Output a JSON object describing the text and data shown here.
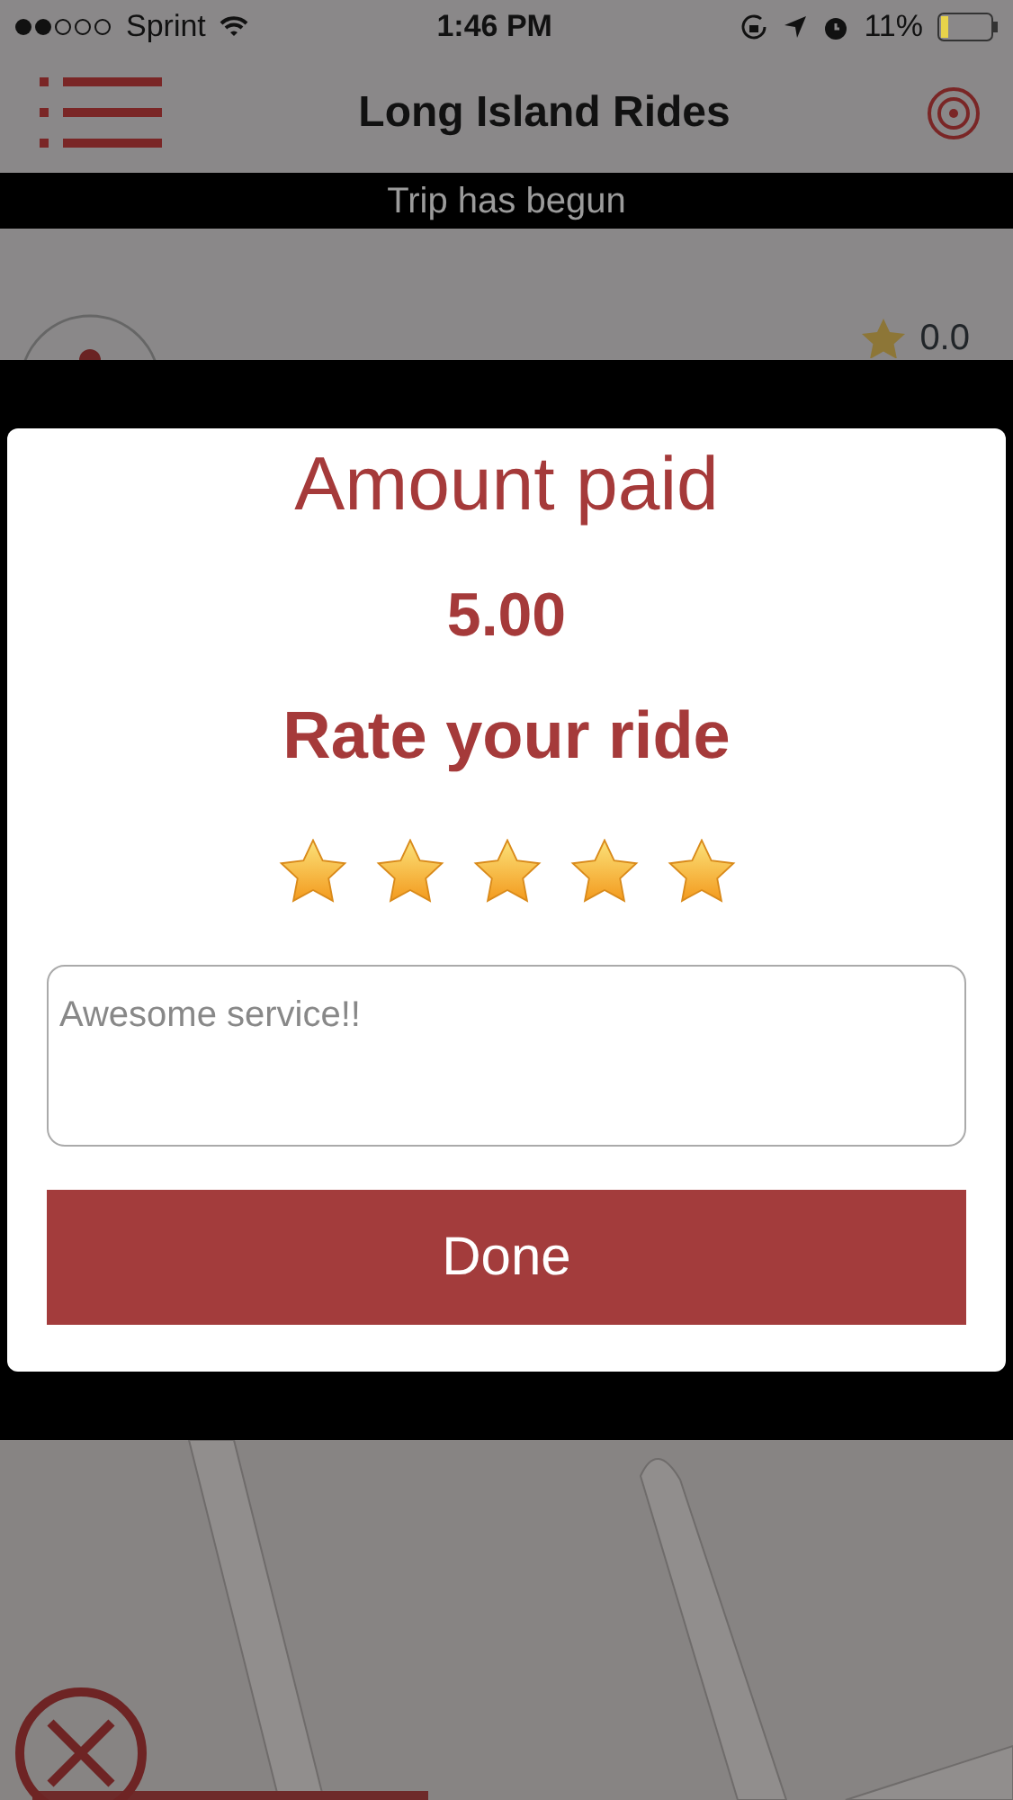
{
  "status_bar": {
    "carrier": "Sprint",
    "time": "1:46 PM",
    "battery": "11%"
  },
  "header": {
    "title": "Long Island Rides"
  },
  "banner": {
    "text": "Trip has begun"
  },
  "driver": {
    "rating": "0.0"
  },
  "dialog": {
    "title": "Amount paid",
    "amount": "5.00",
    "prompt": "Rate your ride",
    "stars": 5,
    "comment": {
      "value": "Awesome service!!"
    },
    "button": "Done"
  }
}
